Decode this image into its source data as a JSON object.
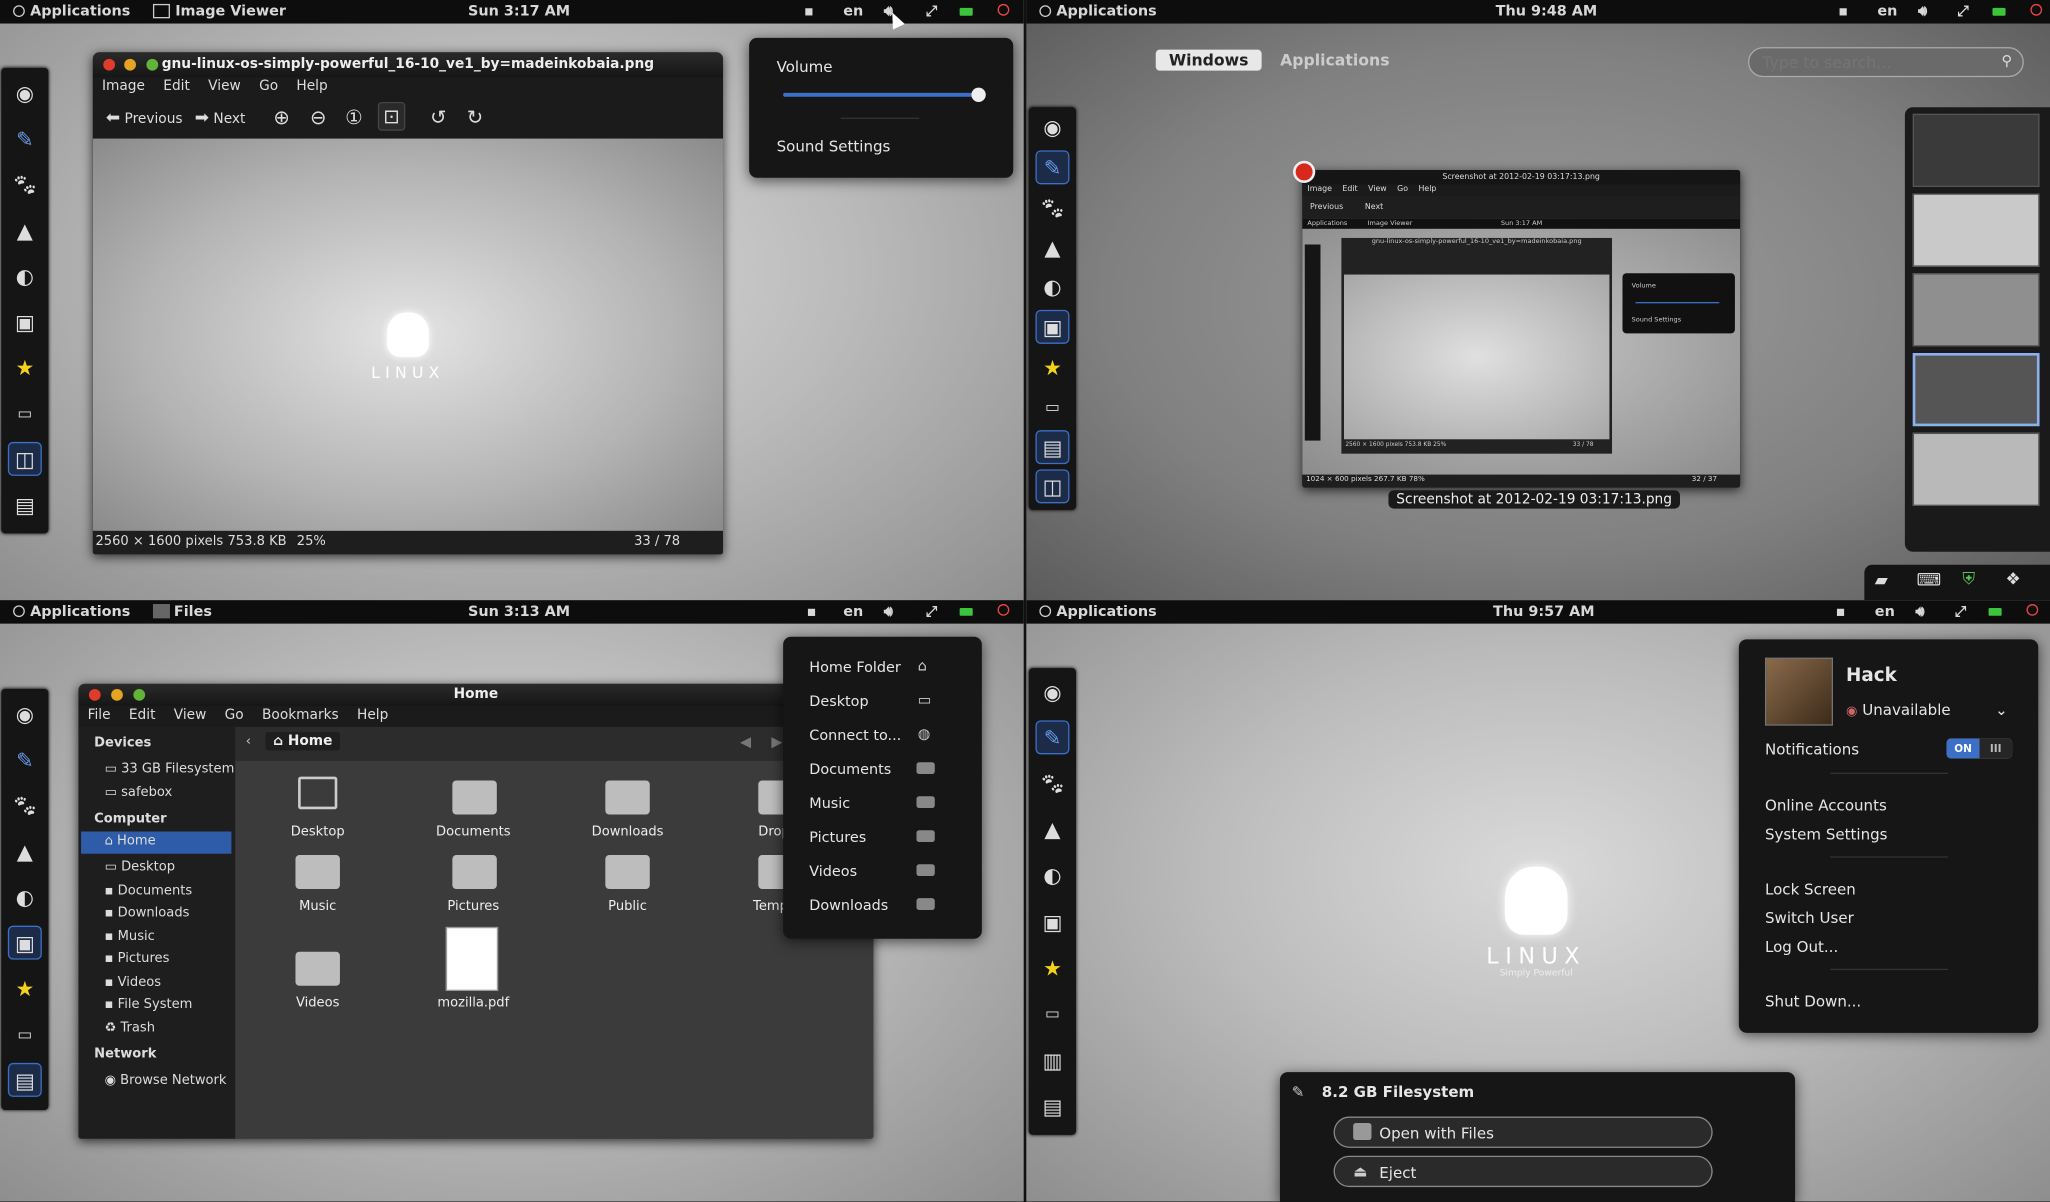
{
  "q1": {
    "apps": "Applications",
    "active_app": "Image Viewer",
    "clock": "Sun  3:17 AM",
    "lang": "en",
    "window": {
      "title": "gnu-linux-os-simply-powerful_16-10_ve1_by=madeinkobaia.png",
      "menu": [
        "Image",
        "Edit",
        "View",
        "Go",
        "Help"
      ],
      "prev": "Previous",
      "next": "Next",
      "logo": "LINUX",
      "status_dims": "2560 × 1600 pixels",
      "status_size": "753.8 KB",
      "status_zoom": "25%",
      "status_count": "33 / 78"
    },
    "volume_popup": {
      "title": "Volume",
      "level": 0.99,
      "sound_settings": "Sound Settings"
    }
  },
  "q2": {
    "apps": "Applications",
    "clock": "Thu  9:48 AM",
    "lang": "en",
    "tabs": {
      "windows": "Windows",
      "applications": "Applications"
    },
    "search_placeholder": "Type to search...",
    "preview": {
      "title": "Screenshot at 2012-02-19 03:17:13.png",
      "menu": [
        "Image",
        "Edit",
        "View",
        "Go",
        "Help"
      ],
      "prev": "Previous",
      "next": "Next",
      "inner_apps": "Applications",
      "inner_app": "Image Viewer",
      "inner_clock": "Sun  3:17 AM",
      "inner_title": "gnu-linux-os-simply-powerful_16-10_ve1_by=madeinkobaia.png",
      "inner_menu": [
        "Image",
        "Edit",
        "View",
        "Go",
        "Help"
      ],
      "inner_volume": "Volume",
      "inner_sound": "Sound Settings",
      "inner_status": "2560 × 1600 pixels  753.8 KB   25%",
      "inner_count": "33 / 78",
      "status": "1024 × 600 pixels  267.7 KB   78%",
      "count": "32 / 37"
    },
    "caption": "Screenshot at 2012-02-19 03:17:13.png"
  },
  "q3": {
    "apps": "Applications",
    "active_app": "Files",
    "clock": "Sun  3:13 AM",
    "lang": "en",
    "window": {
      "title": "Home",
      "menu": [
        "File",
        "Edit",
        "View",
        "Go",
        "Bookmarks",
        "Help"
      ],
      "path": "Home",
      "devices_header": "Devices",
      "devices": [
        "33 GB Filesystem",
        "safebox"
      ],
      "computer_header": "Computer",
      "computer": [
        "Home",
        "Desktop",
        "Documents",
        "Downloads",
        "Music",
        "Pictures",
        "Videos",
        "File System",
        "Trash"
      ],
      "network_header": "Network",
      "network": [
        "Browse Network"
      ],
      "files": [
        "Desktop",
        "Documents",
        "Downloads",
        "Drop",
        "Music",
        "Pictures",
        "Public",
        "Temp",
        "Videos",
        "mozilla.pdf"
      ]
    },
    "places_popup": [
      "Home Folder",
      "Desktop",
      "Connect to...",
      "Documents",
      "Music",
      "Pictures",
      "Videos",
      "Downloads"
    ]
  },
  "q4": {
    "apps": "Applications",
    "clock": "Thu  9:57 AM",
    "lang": "en",
    "logo": "LINUX",
    "logo_sub": "Simply Powerful",
    "user_menu": {
      "name": "Hack",
      "status": "Unavailable",
      "notifications": "Notifications",
      "toggle_on": "ON",
      "toggle_off": "III",
      "online_accounts": "Online Accounts",
      "system_settings": "System Settings",
      "lock_screen": "Lock Screen",
      "switch_user": "Switch User",
      "log_out": "Log Out...",
      "shut_down": "Shut Down..."
    },
    "device_notice": {
      "title": "8.2 GB Filesystem",
      "open": "Open with Files",
      "eject": "Eject"
    }
  },
  "colors": {
    "accent": "#3b6fc8",
    "battery": "#3cc43c",
    "panel": "#0d0d0d"
  }
}
